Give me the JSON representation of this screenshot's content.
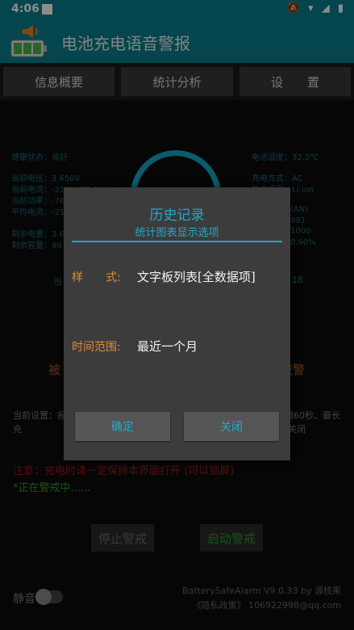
{
  "status": {
    "time": "4:06",
    "icons": "🔕 ▾ ◢ ▮"
  },
  "app": {
    "title": "电池充电语音警报"
  },
  "tabs": [
    "信息概要",
    "统计分析",
    "设　　置"
  ],
  "background": {
    "left_lines": [
      "健康状态：良好",
      "当前电压：3.650V",
      "当前电流：-2111497.6 mA",
      "当前功率：-76.",
      "平均电流：-21",
      "剩余电量：3.6",
      "剩余容量：99"
    ],
    "right_lines": [
      "电池温度：32.2℃",
      "充电方式：AC",
      "技术类型：Li-ion",
      "(AN)",
      "991",
      "1000",
      "0.90%"
    ],
    "left_mid": "当",
    "right_mid": "18",
    "warn_left": "被",
    "warn_right": "瓷警",
    "settings_text": "当前设置：报　　　　　　　　　　　　　　　　　　　　数3次、间隔60秒、最长充　　　　　　　　　　　　　　　　　　　　灯已关闭、自动运行已关闭",
    "red_warning": "注意：充电时请一定保持本界面打开 (可以锁屏)",
    "green_status": "*正在警戒中......"
  },
  "bottom": {
    "stop_label": "停止警戒",
    "start_label": "启动警戒",
    "mute_label": "静音",
    "version": "BatterySafeAlarm V9.0.33 by 源核果",
    "privacy": "《隐私政策》 106922998@qq.com"
  },
  "dialog": {
    "title": "历史记录",
    "subtitle": "统计图表显示选项",
    "style_label": "样　　式:",
    "style_value": "文字板列表[全数据项]",
    "range_label": "时间范围:",
    "range_value": "最近一个月",
    "ok_label": "确定",
    "close_label": "关闭"
  },
  "colors": {
    "accent": "#22a9c9",
    "appbar": "#0a7f8d",
    "label_orange": "#e08a3a"
  }
}
